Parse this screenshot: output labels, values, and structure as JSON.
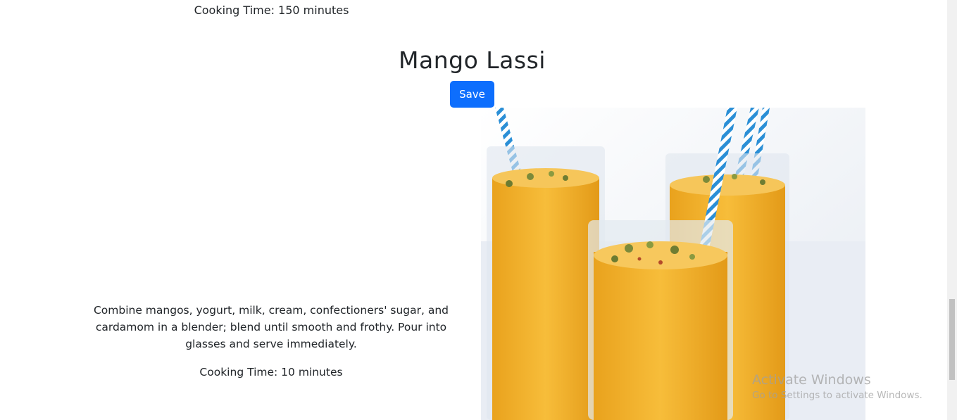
{
  "previous_recipe": {
    "cooking_time": "Cooking Time: 150 minutes"
  },
  "recipe": {
    "title": "Mango Lassi",
    "save_label": "Save",
    "instructions": "Combine mangos, yogurt, milk, cream, confectioners' sugar, and cardamom in a blender; blend until smooth and frothy. Pour into glasses and serve immediately.",
    "cooking_time": "Cooking Time: 10 minutes",
    "image_icon": "mango-lassi-photo"
  },
  "os_watermark": {
    "title": "Activate Windows",
    "subtitle": "Go to Settings to activate Windows."
  },
  "colors": {
    "accent": "#0d6efd",
    "lassi": "#f4b52e"
  }
}
